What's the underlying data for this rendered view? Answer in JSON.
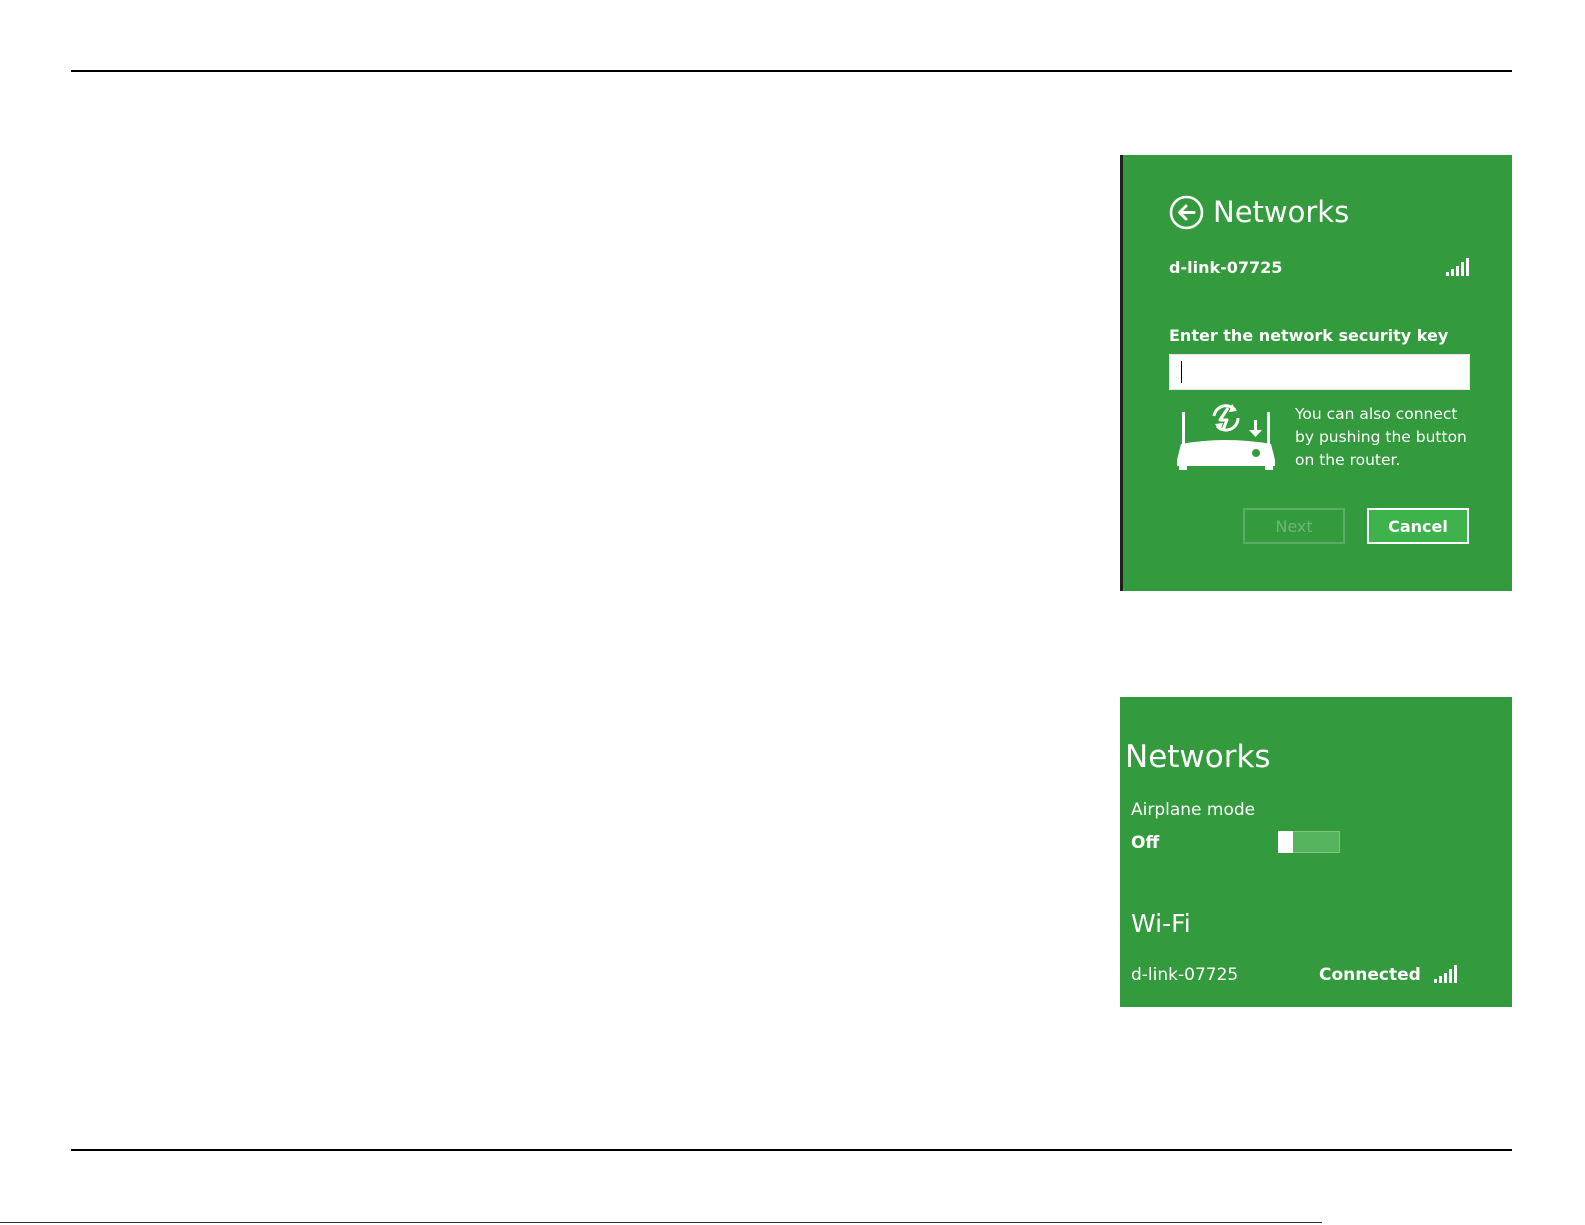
{
  "key_dialog": {
    "title": "Networks",
    "ssid": "d-link-07725",
    "key_label": "Enter the network security key",
    "key_value": "",
    "wps_text": [
      "You can also connect",
      "by pushing the button",
      "on the router."
    ],
    "next_label": "Next",
    "cancel_label": "Cancel",
    "signal_bars": 5
  },
  "networks_panel": {
    "title": "Networks",
    "airplane_label": "Airplane mode",
    "airplane_state": "Off",
    "wifi_heading": "Wi-Fi",
    "network": {
      "ssid": "d-link-07725",
      "status": "Connected",
      "signal_bars": 5
    }
  },
  "colors": {
    "panel_green": "#339a3d",
    "text": "#ffffff"
  }
}
